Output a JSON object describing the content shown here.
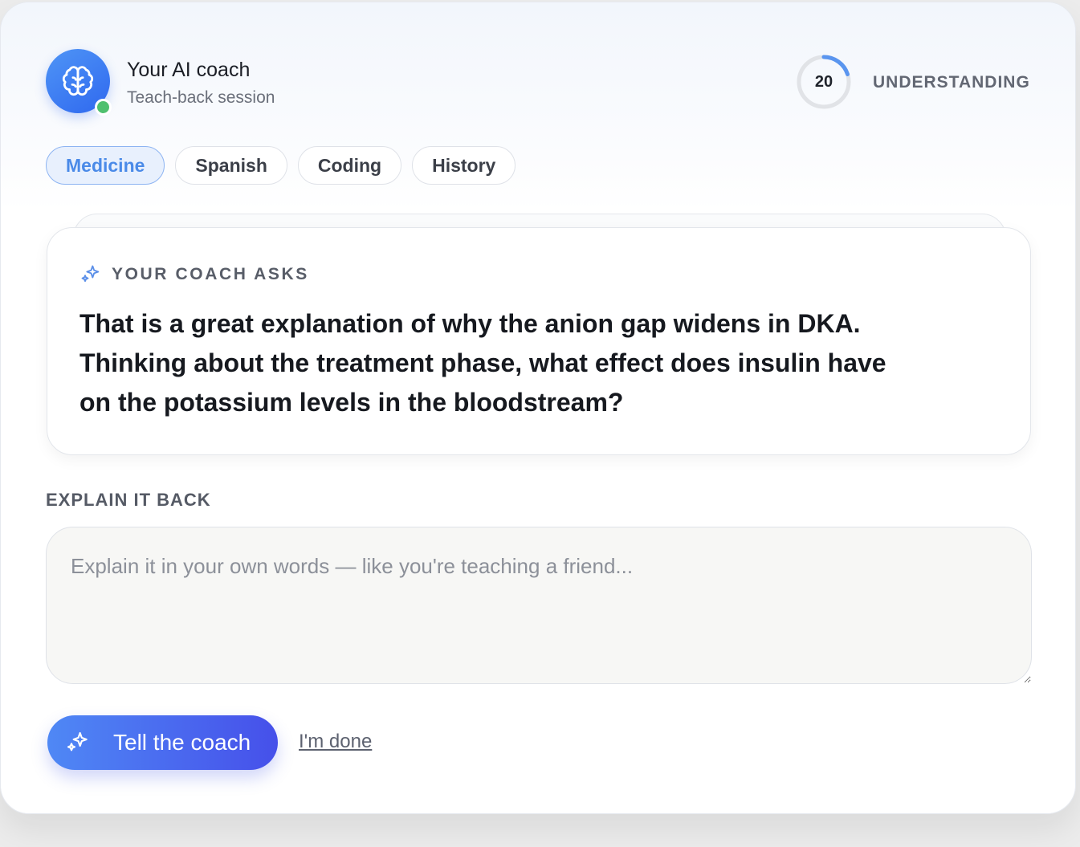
{
  "header": {
    "title": "Your AI coach",
    "subtitle": "Teach-back session",
    "avatar_icon": "brain-icon",
    "status": "online",
    "understanding": {
      "value": "20",
      "percent": 20,
      "label": "UNDERSTANDING"
    }
  },
  "tabs": [
    {
      "label": "Medicine",
      "active": true
    },
    {
      "label": "Spanish",
      "active": false
    },
    {
      "label": "Coding",
      "active": false
    },
    {
      "label": "History",
      "active": false
    }
  ],
  "question": {
    "label": "YOUR COACH ASKS",
    "icon": "sparkles-icon",
    "text": "That is a great explanation of why the anion gap widens in DKA. Thinking about the treatment phase, what effect does insulin have on the potassium levels in the bloodstream?"
  },
  "answer": {
    "label": "EXPLAIN IT BACK",
    "placeholder": "Explain it in your own words — like you're teaching a friend...",
    "value": ""
  },
  "actions": {
    "submit_label": "Tell the coach",
    "submit_icon": "sparkles-icon",
    "done_label": "I'm done"
  },
  "colors": {
    "accent": "#4a8ae8",
    "button_gradient_start": "#4f88f5",
    "button_gradient_end": "#4650ea",
    "online": "#4fc06f",
    "ring_track": "#e1e3e7"
  }
}
